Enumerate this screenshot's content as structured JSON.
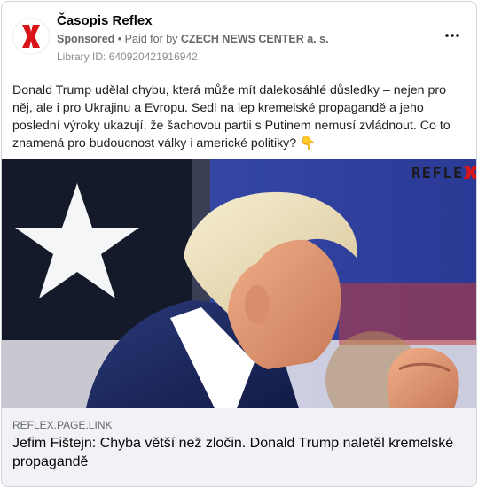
{
  "ad": {
    "page_name": "Časopis Reflex",
    "sponsored_label": "Sponsored",
    "separator": "•",
    "paid_for_prefix": "Paid for by",
    "advertiser": "CZECH NEWS CENTER a. s.",
    "library_id": "Library ID: 640920421916942",
    "more_icon": "more-horizontal-icon"
  },
  "post": {
    "text": "Donald Trump udělal chybu, která může mít dalekosáhlé důsledky – nejen pro něj, ale i pro Ukrajinu a Evropu. Sedl na lep kremelské propagandě a jeho poslední výroky ukazují, že šachovou partii s Putinem nemusí zvládnout. Co to znamená pro budoucnost války i americké politiky? 👇"
  },
  "media": {
    "watermark": "REFLEX",
    "colors": {
      "brand_red": "#d7141a",
      "navy": "#1f2d63",
      "flag_blue": "#24307a"
    }
  },
  "link": {
    "domain": "REFLEX.PAGE.LINK",
    "title": "Jefim Fištejn: Chyba větší než zločin. Donald Trump naletěl kremelské propagandě"
  }
}
